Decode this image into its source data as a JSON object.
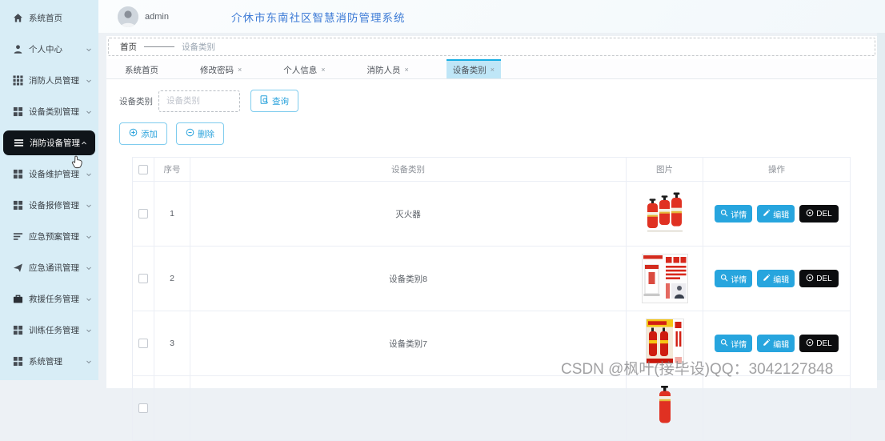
{
  "ui": {
    "close_symbol": "×"
  },
  "header": {
    "username": "admin",
    "title": "介休市东南社区智慧消防管理系统"
  },
  "sidebar": {
    "items": [
      {
        "label": "系统首页"
      },
      {
        "label": "个人中心"
      },
      {
        "label": "消防人员管理"
      },
      {
        "label": "设备类别管理"
      },
      {
        "label": "消防设备管理"
      },
      {
        "label": "设备维护管理"
      },
      {
        "label": "设备报修管理"
      },
      {
        "label": "应急预案管理"
      },
      {
        "label": "应急通讯管理"
      },
      {
        "label": "救援任务管理"
      },
      {
        "label": "训练任务管理"
      },
      {
        "label": "系统管理"
      }
    ]
  },
  "breadcrumb": {
    "root": "首页",
    "current": "设备类别"
  },
  "tabs": [
    {
      "label": "系统首页",
      "closable": false,
      "active": false
    },
    {
      "label": "修改密码",
      "closable": true,
      "active": false
    },
    {
      "label": "个人信息",
      "closable": true,
      "active": false
    },
    {
      "label": "消防人员",
      "closable": true,
      "active": false
    },
    {
      "label": "设备类别",
      "closable": true,
      "active": true
    }
  ],
  "filter": {
    "label": "设备类别",
    "placeholder": "设备类别",
    "search_button": "查询"
  },
  "toolbar": {
    "add_button": "添加",
    "delete_button": "删除"
  },
  "table": {
    "columns": {
      "index": "序号",
      "category": "设备类别",
      "image": "图片",
      "action": "操作"
    },
    "row_buttons": {
      "detail": "详情",
      "edit": "编辑",
      "del": "DEL"
    },
    "rows": [
      {
        "index": "1",
        "category": "灭火器",
        "image": "fire-extinguishers"
      },
      {
        "index": "2",
        "category": "设备类别8",
        "image": "fire-hydrant-poster"
      },
      {
        "index": "3",
        "category": "设备类别7",
        "image": "fire-extinguisher-poster"
      },
      {
        "index": "",
        "category": "",
        "image": "fire-extinguisher-partial"
      }
    ]
  },
  "watermark": "CSDN @枫叶(接毕设)QQ：3042127848",
  "colors": {
    "accent": "#28a6e0",
    "sidebar_bg": "#d8edf6",
    "active_menu_bg": "#0f1419",
    "tab_active_bg": "#bfe6f7",
    "tab_active_border": "#17aee3",
    "title_blue": "#3f7cd6",
    "del_button_bg": "#0c0d0f"
  }
}
